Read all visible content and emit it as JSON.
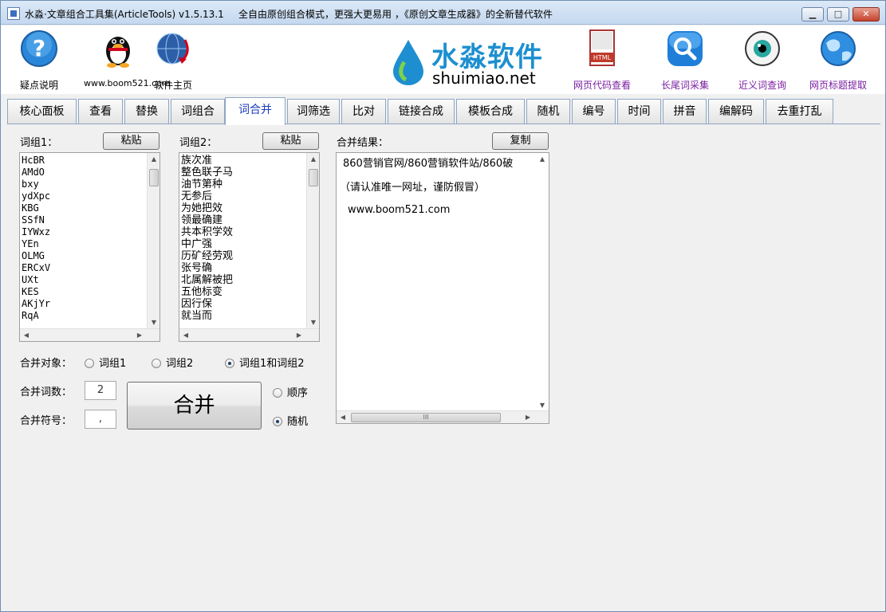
{
  "window": {
    "title": "水淼·文章组合工具集(ArticleTools) v1.5.13.1",
    "slogan": "全自由原创组合模式，更强大更易用 ，《原创文章生成器》的全新替代软件",
    "controls": {
      "minimize": "▁",
      "maximize": "□",
      "close": "✕"
    }
  },
  "toolbar": {
    "items": [
      {
        "label": "疑点说明",
        "icon": "help-icon"
      },
      {
        "label": "www.boom521.com",
        "icon": "qq-penguin-icon"
      },
      {
        "label": "软件主页",
        "icon": "globe-icon"
      },
      {
        "label": "网页代码查看",
        "icon": "html-file-icon"
      },
      {
        "label": "长尾词采集",
        "icon": "search-icon"
      },
      {
        "label": "近义词查询",
        "icon": "eye-icon"
      },
      {
        "label": "网页标题提取",
        "icon": "web-globe-icon"
      }
    ],
    "logo": {
      "cn": "水淼软件",
      "en": "shuimiao.net"
    }
  },
  "tabs": [
    "核心面板",
    "查看",
    "替换",
    "词组合",
    "词合并",
    "词筛选",
    "比对",
    "链接合成",
    "模板合成",
    "随机",
    "编号",
    "时间",
    "拼音",
    "编解码",
    "去重打乱"
  ],
  "active_tab": "词合并",
  "group1": {
    "label": "词组1：",
    "paste": "粘贴",
    "items": [
      "HcBR",
      "AMdO",
      "bxy",
      "ydXpc",
      "KBG",
      "SSfN",
      "IYWxz",
      "YEn",
      "OLMG",
      "ERCxV",
      "UXt",
      "KES",
      "AKjYr",
      "RqA"
    ]
  },
  "group2": {
    "label": "词组2：",
    "paste": "粘贴",
    "items": [
      "族次准",
      "整色联子马",
      "油节第种",
      "无参后",
      "为她把效",
      "领最确建",
      "共本积学效",
      "中广强",
      "历矿经劳观",
      "张号确",
      "北属解被把",
      "五他标变",
      "因行保",
      "就当而"
    ]
  },
  "result": {
    "label": "合并结果：",
    "copy": "复制",
    "lines": [
      "860营销官网/860营销软件站/860破",
      "（请认准唯一网址，谨防假冒）",
      "www.boom521.com"
    ]
  },
  "merge_target": {
    "label": "合并对象：",
    "options": [
      "词组1",
      "词组2",
      "词组1和词组2"
    ],
    "selected": "词组1和词组2"
  },
  "merge_count": {
    "label": "合并词数：",
    "value": "2"
  },
  "merge_symbol": {
    "label": "合并符号：",
    "value": ","
  },
  "merge_button": "合并",
  "order": {
    "options": [
      "顺序",
      "随机"
    ],
    "selected": "随机"
  },
  "scroll": {
    "up": "▲",
    "down": "▼",
    "left": "◀",
    "right": "▶",
    "grip": "III"
  }
}
